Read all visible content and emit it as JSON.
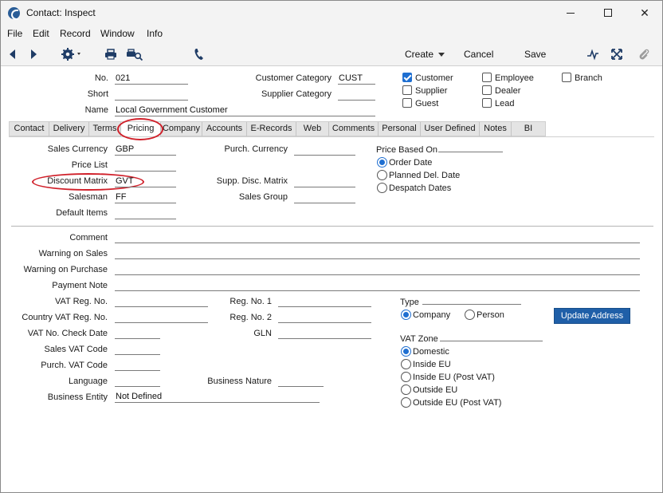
{
  "window": {
    "title": "Contact: Inspect"
  },
  "menu": [
    "File",
    "Edit",
    "Record",
    "Window",
    "Info"
  ],
  "toolbar": {
    "create_label": "Create",
    "cancel_label": "Cancel",
    "save_label": "Save"
  },
  "header": {
    "no_label": "No.",
    "no_value": "021",
    "short_label": "Short",
    "short_value": "",
    "name_label": "Name",
    "name_value": "Local Government Customer",
    "customer_category_label": "Customer Category",
    "customer_category_value": "CUST",
    "supplier_category_label": "Supplier Category",
    "supplier_category_value": ""
  },
  "flags": [
    {
      "label": "Customer",
      "checked": true
    },
    {
      "label": "Supplier",
      "checked": false
    },
    {
      "label": "Guest",
      "checked": false
    },
    {
      "label": "Employee",
      "checked": false
    },
    {
      "label": "Dealer",
      "checked": false
    },
    {
      "label": "Lead",
      "checked": false
    },
    {
      "label": "Branch",
      "checked": false
    }
  ],
  "tabs": [
    "Contact",
    "Delivery",
    "Terms",
    "Pricing",
    "Company",
    "Accounts",
    "E-Records",
    "Web",
    "Comments",
    "Personal",
    "User Defined",
    "Notes",
    "BI"
  ],
  "active_tab": "Pricing",
  "pricing": {
    "sales_currency_label": "Sales Currency",
    "sales_currency_value": "GBP",
    "price_list_label": "Price List",
    "price_list_value": "",
    "discount_matrix_label": "Discount Matrix",
    "discount_matrix_value": "GVT",
    "salesman_label": "Salesman",
    "salesman_value": "FF",
    "default_items_label": "Default Items",
    "default_items_value": "",
    "purch_currency_label": "Purch. Currency",
    "purch_currency_value": "",
    "supp_disc_matrix_label": "Supp. Disc. Matrix",
    "supp_disc_matrix_value": "",
    "sales_group_label": "Sales Group",
    "sales_group_value": "",
    "price_based_on_label": "Price Based On",
    "price_based_on_options": [
      {
        "label": "Order Date",
        "selected": true
      },
      {
        "label": "Planned Del. Date",
        "selected": false
      },
      {
        "label": "Despatch Dates",
        "selected": false
      }
    ]
  },
  "lower": {
    "comment_label": "Comment",
    "comment_value": "",
    "warning_sales_label": "Warning on Sales",
    "warning_sales_value": "",
    "warning_purchase_label": "Warning on Purchase",
    "warning_purchase_value": "",
    "payment_note_label": "Payment Note",
    "payment_note_value": "",
    "vat_reg_label": "VAT Reg. No.",
    "vat_reg_value": "",
    "country_vat_reg_label": "Country VAT Reg. No.",
    "country_vat_reg_value": "",
    "vat_check_date_label": "VAT No. Check Date",
    "vat_check_date_value": "",
    "sales_vat_code_label": "Sales VAT Code",
    "sales_vat_code_value": "",
    "purch_vat_code_label": "Purch. VAT Code",
    "purch_vat_code_value": "",
    "language_label": "Language",
    "language_value": "",
    "business_entity_label": "Business Entity",
    "business_entity_value": "Not Defined",
    "reg1_label": "Reg. No. 1",
    "reg1_value": "",
    "reg2_label": "Reg. No. 2",
    "reg2_value": "",
    "gln_label": "GLN",
    "gln_value": "",
    "business_nature_label": "Business Nature",
    "business_nature_value": "",
    "type_label": "Type",
    "type_options": [
      {
        "label": "Company",
        "selected": true
      },
      {
        "label": "Person",
        "selected": false
      }
    ],
    "update_address_label": "Update Address",
    "vat_zone_label": "VAT Zone",
    "vat_zone_options": [
      {
        "label": "Domestic",
        "selected": true
      },
      {
        "label": "Inside EU",
        "selected": false
      },
      {
        "label": "Inside EU (Post VAT)",
        "selected": false
      },
      {
        "label": "Outside EU",
        "selected": false
      },
      {
        "label": "Outside EU (Post VAT)",
        "selected": false
      }
    ]
  },
  "colors": {
    "accent": "#1f6fd1",
    "highlight": "#d0202a",
    "button": "#1f5fa8"
  }
}
